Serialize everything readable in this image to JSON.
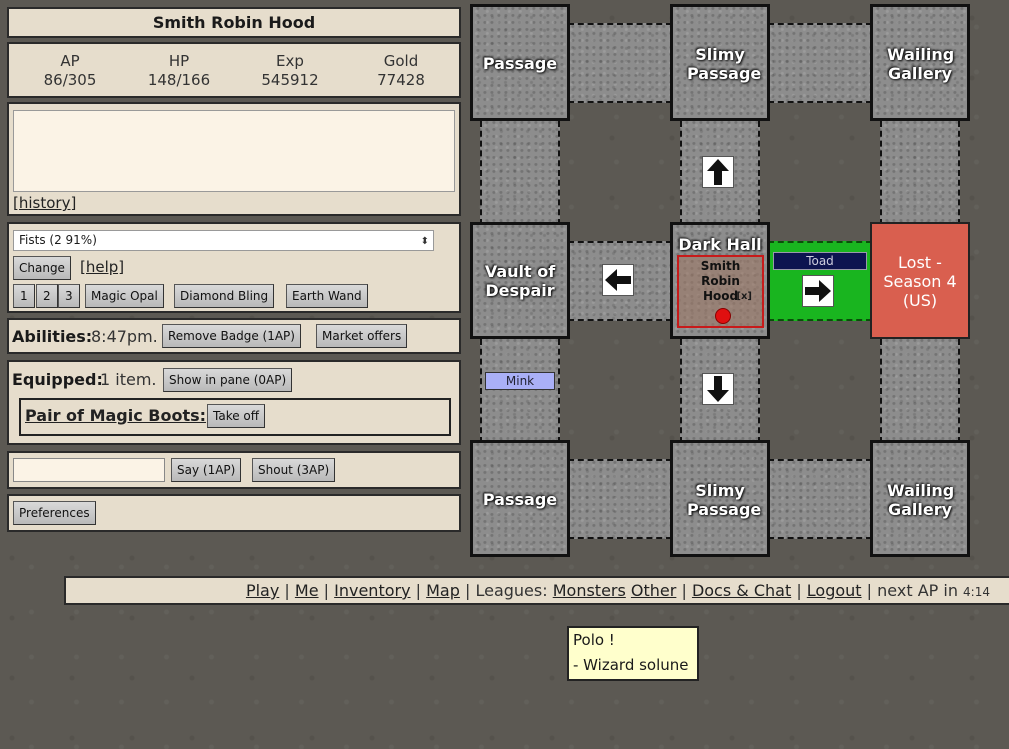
{
  "character": {
    "name": "Smith Robin Hood"
  },
  "stats": [
    {
      "label": "AP",
      "value": "86/305"
    },
    {
      "label": "HP",
      "value": "148/166"
    },
    {
      "label": "Exp",
      "value": "545912"
    },
    {
      "label": "Gold",
      "value": "77428"
    }
  ],
  "messages": {
    "history_link": "[history]"
  },
  "weapon": {
    "selected": "Fists (2 91%)",
    "change_label": "Change",
    "help_link": "[help]",
    "slots": [
      "1",
      "2",
      "3"
    ],
    "items": [
      "Magic Opal",
      "Diamond Bling",
      "Earth Wand"
    ]
  },
  "abilities": {
    "label": "Abilities:",
    "time": "8:47pm.",
    "remove_badge": "Remove Badge (1AP)",
    "market": "Market offers"
  },
  "equipped": {
    "label": "Equipped:",
    "count": "1 item.",
    "show_pane": "Show in pane (0AP)",
    "item_name": "Pair of Magic Boots:",
    "take_off": "Take off"
  },
  "speech": {
    "say": "Say (1AP)",
    "shout": "Shout (3AP)"
  },
  "preferences": {
    "label": "Preferences"
  },
  "map": {
    "rooms": {
      "nw": "Passage",
      "n": "Slimy Passage",
      "ne": "Wailing Gallery",
      "w": "Vault of Despair",
      "center": "Dark Hall",
      "e": "Lost - Season 4 (US)",
      "sw": "Passage",
      "s": "Slimy Passage",
      "se": "Wailing Gallery"
    },
    "player_card": {
      "name": "Smith Robin Hood",
      "close": "[x]"
    },
    "monsters": {
      "east": "Toad",
      "southwest": "Mink"
    },
    "colors": {
      "lost_room": "#d95f4f",
      "monster_corridor": "#19b51f",
      "player_border": "#c81a1a",
      "toad_badge": "#0d1450",
      "mink_badge": "#aab0f7"
    }
  },
  "nav": {
    "play": "Play",
    "sep1": "|",
    "me": "Me",
    "sep2": "|",
    "inventory": "Inventory",
    "sep3": "|",
    "map": "Map",
    "sep4": "|",
    "leagues_label": "Leagues:",
    "monsters": "Monsters",
    "other": "Other",
    "sep5": "|",
    "docs": "Docs & Chat",
    "sep6": "|",
    "logout": "Logout",
    "sep7": "|",
    "next_ap_label": "next AP in",
    "next_ap_time": "4:14"
  },
  "tooltip": {
    "line1": "Polo !",
    "line2": "- Wizard solune"
  }
}
